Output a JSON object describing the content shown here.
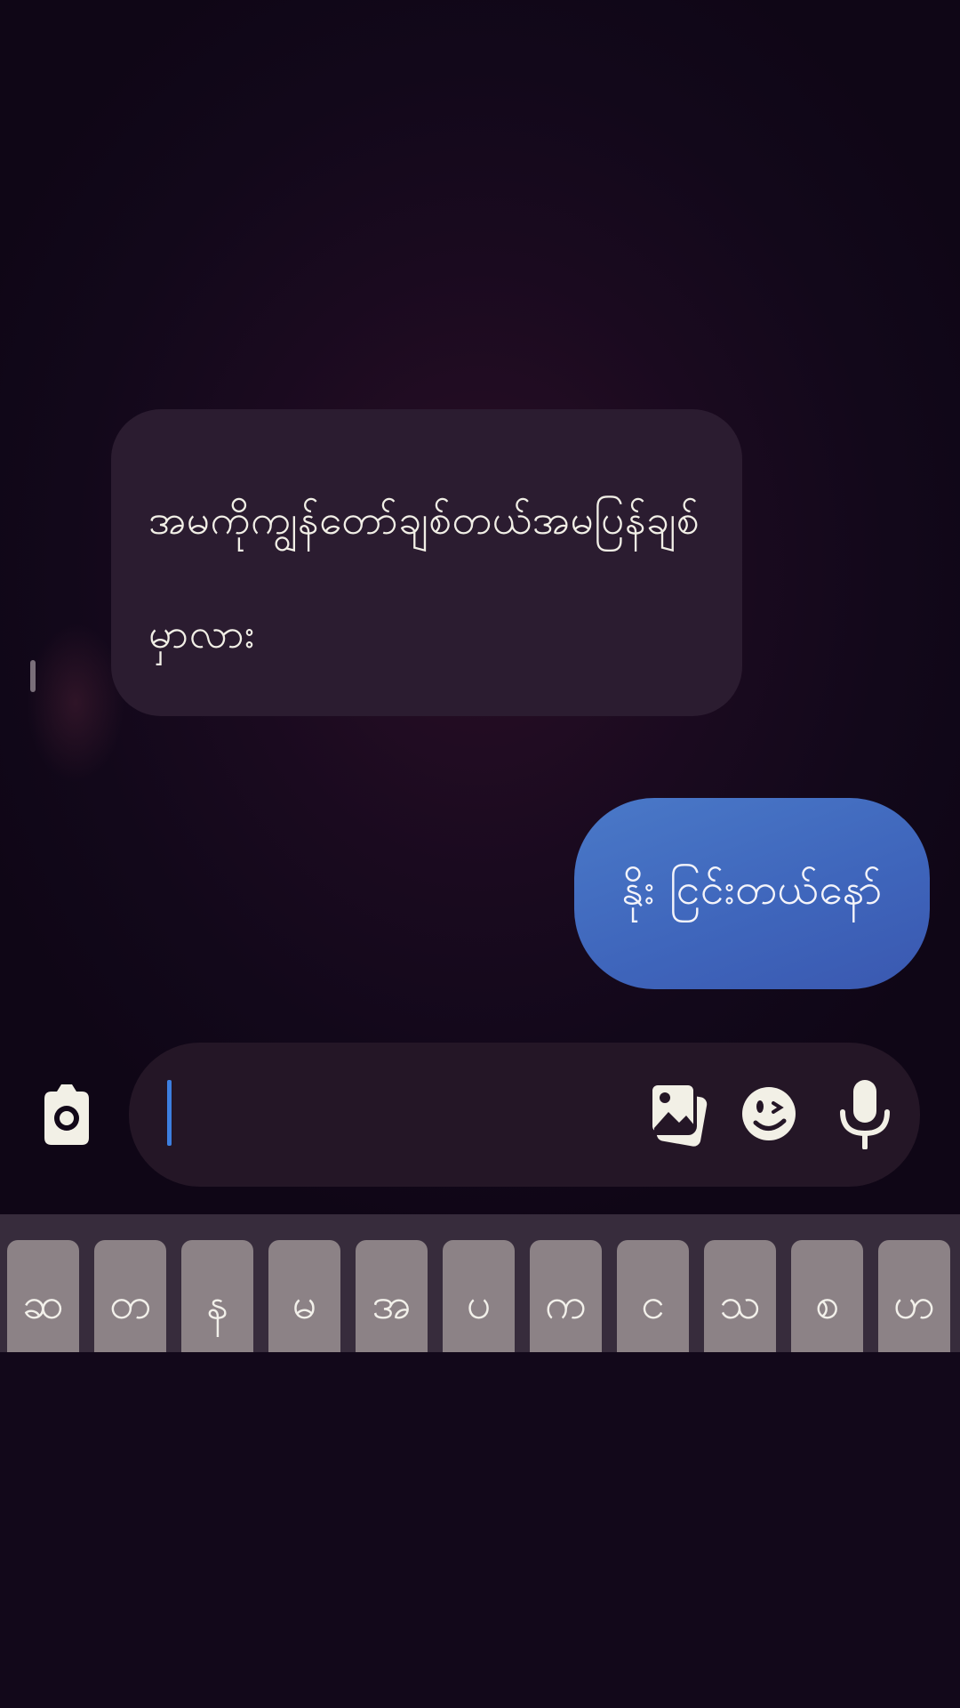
{
  "conversation": {
    "incoming_message": "အမကိုကျွန်တော်ချစ်တယ်အမပြန်ချစ်မှာလား",
    "outgoing_message": "နိုး ငြင်းတယ်နော်"
  },
  "composer": {
    "camera_icon": "camera-icon",
    "gallery_icon": "gallery-icon",
    "emoji_icon": "emoji-icon",
    "mic_icon": "microphone-icon",
    "value": ""
  },
  "keyboard": {
    "keys": [
      "ဆ",
      "တ",
      "န",
      "မ",
      "အ",
      "ပ",
      "က",
      "င",
      "သ",
      "စ",
      "ဟ"
    ]
  },
  "colors": {
    "background": "#120818",
    "incoming_bubble": "#2b1c30",
    "outgoing_bubble": "#4370c2",
    "cursor": "#3d7fe0",
    "key": "#8c8286"
  }
}
